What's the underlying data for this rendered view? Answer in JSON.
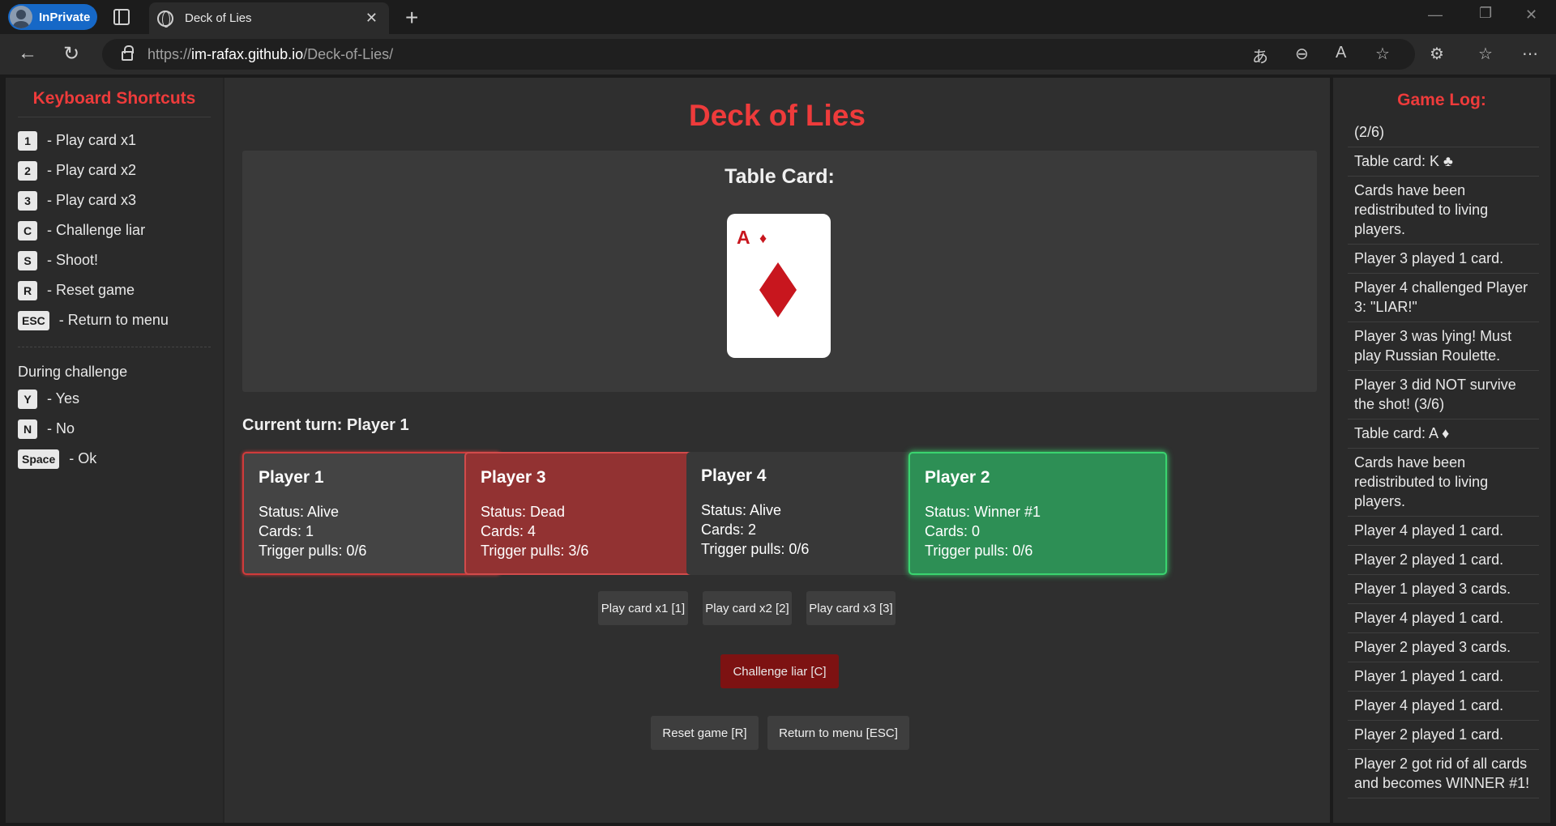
{
  "browser": {
    "inprivate_label": "InPrivate",
    "tab_title": "Deck of Lies",
    "url_scheme": "https://",
    "url_host": "im-rafax.github.io",
    "url_path": "/Deck-of-Lies/"
  },
  "shortcuts": {
    "title": "Keyboard Shortcuts",
    "items": [
      {
        "key": "1",
        "label": "- Play card x1"
      },
      {
        "key": "2",
        "label": "- Play card x2"
      },
      {
        "key": "3",
        "label": "- Play card x3"
      },
      {
        "key": "C",
        "label": "- Challenge liar"
      },
      {
        "key": "S",
        "label": "- Shoot!"
      },
      {
        "key": "R",
        "label": "- Reset game"
      },
      {
        "key": "ESC",
        "label": "- Return to menu"
      }
    ],
    "during_label": "During challenge",
    "challenge_items": [
      {
        "key": "Y",
        "label": "- Yes"
      },
      {
        "key": "N",
        "label": "- No"
      },
      {
        "key": "Space",
        "label": "- Ok"
      }
    ]
  },
  "game": {
    "title": "Deck of Lies",
    "table_label": "Table Card:",
    "table_card": {
      "rank": "A",
      "suit": "♦",
      "suit_color": "#c8161e"
    },
    "current_turn": "Current turn: Player 1",
    "players": [
      {
        "name": "Player 1",
        "status": "Status: Alive",
        "cards": "Cards: 1",
        "triggers": "Trigger pulls: 0/6",
        "state": "current"
      },
      {
        "name": "Player 3",
        "status": "Status: Dead",
        "cards": "Cards: 4",
        "triggers": "Trigger pulls: 3/6",
        "state": "dead"
      },
      {
        "name": "Player 4",
        "status": "Status: Alive",
        "cards": "Cards: 2",
        "triggers": "Trigger pulls: 0/6",
        "state": "alive"
      },
      {
        "name": "Player 2",
        "status": "Status: Winner #1",
        "cards": "Cards: 0",
        "triggers": "Trigger pulls: 0/6",
        "state": "winner"
      }
    ],
    "buttons": {
      "play1": "Play card x1 [1]",
      "play2": "Play card x2 [2]",
      "play3": "Play card x3 [3]",
      "challenge": "Challenge liar [C]",
      "reset": "Reset game [R]",
      "menu": "Return to menu [ESC]"
    }
  },
  "log": {
    "title": "Game Log:",
    "items": [
      "(2/6)",
      "Table card: K ♣",
      "Cards have been redistributed to living players.",
      "Player 3 played 1 card.",
      "Player 4 challenged Player 3: \"LIAR!\"",
      "Player 3 was lying! Must play Russian Roulette.",
      "Player 3 did NOT survive the shot! (3/6)",
      "Table card: A ♦",
      "Cards have been redistributed to living players.",
      "Player 4 played 1 card.",
      "Player 2 played 1 card.",
      "Player 1 played 3 cards.",
      "Player 4 played 1 card.",
      "Player 2 played 3 cards.",
      "Player 1 played 1 card.",
      "Player 4 played 1 card.",
      "Player 2 played 1 card.",
      "Player 2 got rid of all cards and becomes WINNER #1!"
    ]
  }
}
